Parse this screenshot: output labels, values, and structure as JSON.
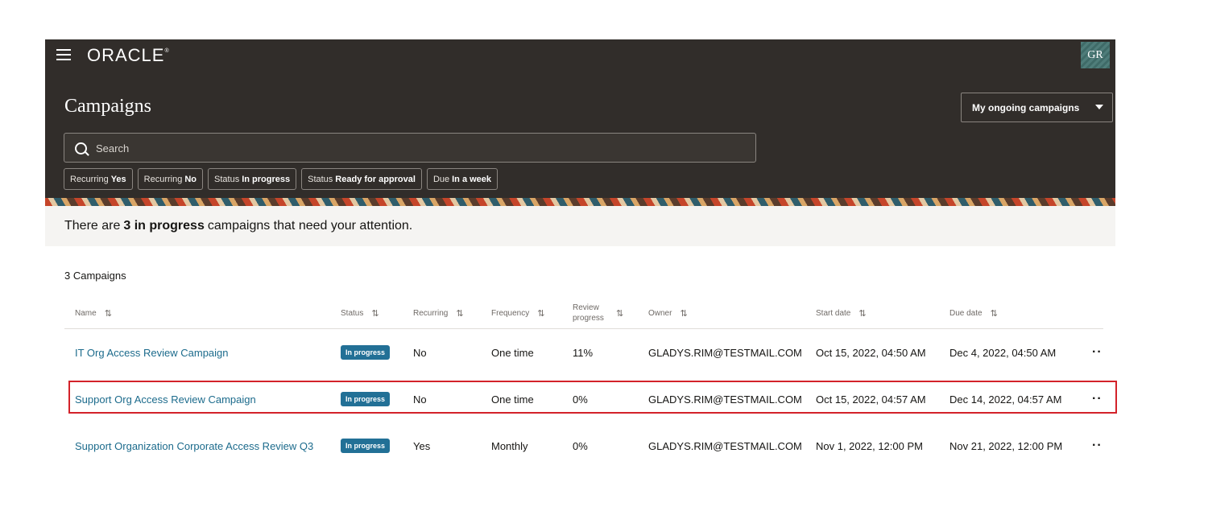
{
  "header": {
    "logo": "ORACLE",
    "avatar_initials": "GR",
    "title": "Campaigns",
    "view_select": "My ongoing campaigns",
    "search_placeholder": "Search",
    "filters": [
      {
        "key": "Recurring",
        "value": "Yes"
      },
      {
        "key": "Recurring",
        "value": "No"
      },
      {
        "key": "Status",
        "value": "In progress"
      },
      {
        "key": "Status",
        "value": "Ready for approval"
      },
      {
        "key": "Due",
        "value": "In a week"
      }
    ]
  },
  "banner": {
    "prefix": "There are",
    "highlight": "3 in progress",
    "suffix": "campaigns that need your attention."
  },
  "table": {
    "count_label": "3 Campaigns",
    "columns": {
      "name": "Name",
      "status": "Status",
      "recurring": "Recurring",
      "frequency": "Frequency",
      "review_progress": "Review progress",
      "owner": "Owner",
      "start_date": "Start date",
      "due_date": "Due date"
    },
    "rows": [
      {
        "name": "IT Org Access Review Campaign",
        "status": "In progress",
        "recurring": "No",
        "frequency": "One time",
        "progress": "11%",
        "owner": "GLADYS.RIM@TESTMAIL.COM",
        "start": "Oct 15, 2022, 04:50 AM",
        "due": "Dec 4, 2022, 04:50 AM"
      },
      {
        "name": "Support Org Access Review Campaign",
        "status": "In progress",
        "recurring": "No",
        "frequency": "One time",
        "progress": "0%",
        "owner": "GLADYS.RIM@TESTMAIL.COM",
        "start": "Oct 15, 2022, 04:57 AM",
        "due": "Dec 14, 2022, 04:57 AM"
      },
      {
        "name": "Support Organization Corporate Access Review Q3",
        "status": "In progress",
        "recurring": "Yes",
        "frequency": "Monthly",
        "progress": "0%",
        "owner": "GLADYS.RIM@TESTMAIL.COM",
        "start": "Nov 1, 2022, 12:00 PM",
        "due": "Nov 21, 2022, 12:00 PM"
      }
    ]
  }
}
